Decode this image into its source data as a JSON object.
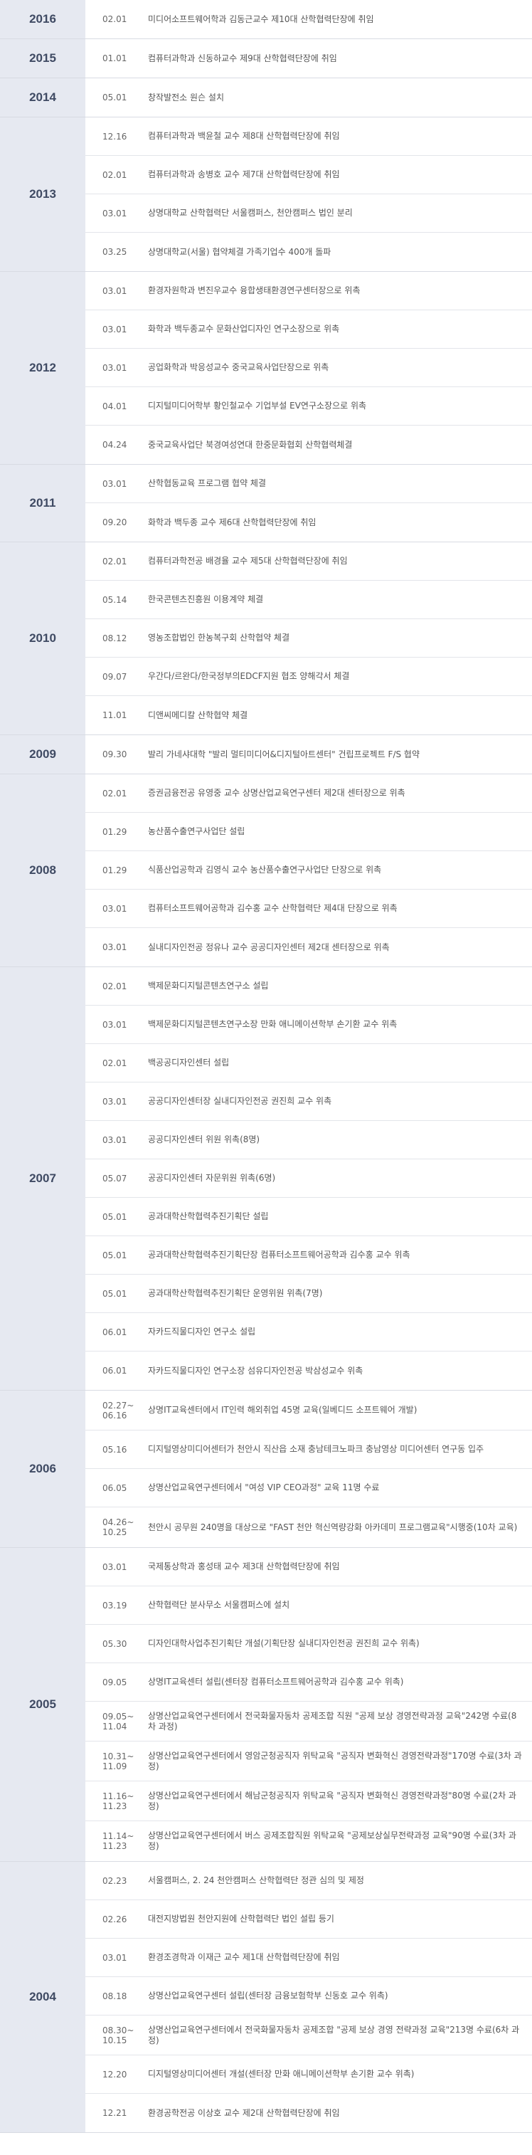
{
  "timeline": [
    {
      "year": "2016",
      "events": [
        {
          "date": "02.01",
          "text": "미디어소프트웨어학과 김동근교수 제10대 산학협력단장에 취임"
        }
      ]
    },
    {
      "year": "2015",
      "events": [
        {
          "date": "01.01",
          "text": "컴퓨터과학과 신동하교수 제9대 산학협력단장에 취임"
        }
      ]
    },
    {
      "year": "2014",
      "events": [
        {
          "date": "05.01",
          "text": "창작발전소 원슨 설치"
        }
      ]
    },
    {
      "year": "2013",
      "events": [
        {
          "date": "12.16",
          "text": "컴퓨터과학과 백윤철 교수 제8대 산학협력단장에 취임"
        },
        {
          "date": "02.01",
          "text": "컴퓨터과학과 송병호 교수 제7대 산학협력단장에 취임"
        },
        {
          "date": "03.01",
          "text": "상명대학교 산학협력단 서울캠퍼스, 천안캠퍼스 법인 분리"
        },
        {
          "date": "03.25",
          "text": "상명대학교(서울) 협약체결 가족기업수 400개 돌파"
        }
      ]
    },
    {
      "year": "2012",
      "events": [
        {
          "date": "03.01",
          "text": "환경자원학과 변진우교수 융합생태환경연구센터장으로 위촉"
        },
        {
          "date": "03.01",
          "text": "화학과 백두종교수 문화산업디자인 연구소장으로 위촉"
        },
        {
          "date": "03.01",
          "text": "공업화학과 박응성교수 중국교육사업단장으로 위촉"
        },
        {
          "date": "04.01",
          "text": "디지털미디어학부 황인철교수 기업부설 EV연구소장으로 위촉"
        },
        {
          "date": "04.24",
          "text": "중국교육사업단 북경여성연대 한중문화협회 산학협력체결"
        }
      ]
    },
    {
      "year": "2011",
      "events": [
        {
          "date": "03.01",
          "text": "산학협동교육 프로그램 협약 체결"
        },
        {
          "date": "09.20",
          "text": "화학과 백두종 교수 제6대 산학협력단장에 취임"
        }
      ]
    },
    {
      "year": "2010",
      "events": [
        {
          "date": "02.01",
          "text": "컴퓨터과학전공 배경율 교수 제5대 산학협력단장에 취임"
        },
        {
          "date": "05.14",
          "text": "한국콘텐츠진흥원 이용계약 체결"
        },
        {
          "date": "08.12",
          "text": "영농조합법인 한농복구회 산학협약 체결"
        },
        {
          "date": "09.07",
          "text": "우간다/르완다/한국정부의EDCF지원 협조 양해각서 체결"
        },
        {
          "date": "11.01",
          "text": "디앤씨메디칼 산학협약 체결"
        }
      ]
    },
    {
      "year": "2009",
      "events": [
        {
          "date": "09.30",
          "text": "발리 가네샤대학 \"발리 멀티미디어&디지털아트센터\" 건립프로젝트 F/S 협약"
        }
      ]
    },
    {
      "year": "2008",
      "events": [
        {
          "date": "02.01",
          "text": "증권금융전공 유영중 교수 상명산업교육연구센터 제2대 센터장으로 위촉"
        },
        {
          "date": "01.29",
          "text": "농산품수출연구사업단 설립"
        },
        {
          "date": "01.29",
          "text": "식품산업공학과 김영식 교수 농산품수출연구사업단 단장으로 위촉"
        },
        {
          "date": "03.01",
          "text": "컴퓨터소프트웨어공학과 김수홍 교수 산학협력단 제4대 단장으로 위촉"
        },
        {
          "date": "03.01",
          "text": "실내디자인전공 정유나 교수 공공디자인센터 제2대 센터장으로 위촉"
        }
      ]
    },
    {
      "year": "2007",
      "events": [
        {
          "date": "02.01",
          "text": "백제문화디지털콘텐츠연구소 설립"
        },
        {
          "date": "03.01",
          "text": "백제문화디지털콘텐츠연구소장 만화 애니메이션학부 손기환 교수 위촉"
        },
        {
          "date": "02.01",
          "text": "백공공디자인센터 설립"
        },
        {
          "date": "03.01",
          "text": "공공디자인센터장 실내디자인전공 권진희 교수 위촉"
        },
        {
          "date": "03.01",
          "text": "공공디자인센터 위원 위촉(8명)"
        },
        {
          "date": "05.07",
          "text": "공공디자인센터 자문위원 위촉(6명)"
        },
        {
          "date": "05.01",
          "text": "공과대학산학협력추진기획단 설립"
        },
        {
          "date": "05.01",
          "text": "공과대학산학협력추진기획단장 컴퓨터소프트웨어공학과 김수홍 교수 위촉"
        },
        {
          "date": "05.01",
          "text": "공과대학산학협력추진기획단 운영위원 위촉(7명)"
        },
        {
          "date": "06.01",
          "text": "자카드직물디자인 연구소 설립"
        },
        {
          "date": "06.01",
          "text": "자카드직물디자인 연구소장 섬유디자인전공 박삼성교수 위촉"
        }
      ]
    },
    {
      "year": "2006",
      "events": [
        {
          "date": "02.27~\n06.16",
          "text": "상명IT교육센터에서 IT인력 해외취업 45명 교육(일베디드 소프트웨어 개발)"
        },
        {
          "date": "05.16",
          "text": "디지털영상미디어센터가 천안시 직산읍 소재 충남테크노파크 충남영상 미디어센터 연구동 입주"
        },
        {
          "date": "06.05",
          "text": "상명산업교육연구센터에서 \"여성 VIP CEO과정\" 교육 11명 수료"
        },
        {
          "date": "04.26~\n10.25",
          "text": "천안시 공무원 240명을 대상으로 \"FAST 천안 혁신역량강화 아카데미 프로그램교육\"시행중(10차 교육)"
        }
      ]
    },
    {
      "year": "2005",
      "events": [
        {
          "date": "03.01",
          "text": "국제통상학과 홍성태 교수 제3대 산학협력단장에 취임"
        },
        {
          "date": "03.19",
          "text": "산학협력단 분사무소 서울캠퍼스에 설치"
        },
        {
          "date": "05.30",
          "text": "디자인대학사업추진기획단 개설(기획단장 실내디자인전공 권진희 교수 위촉)"
        },
        {
          "date": "09.05",
          "text": "상명IT교육센터 설립(센터장 컴퓨터소프트웨어공학과 김수홍 교수 위촉)"
        },
        {
          "date": "09.05~\n11.04",
          "text": "상명산업교육연구센터에서 전국화물자동차 공제조합 직원 \"공제 보상 경영전략과정 교육\"242명 수료(8차 과정)"
        },
        {
          "date": "10.31~\n11.09",
          "text": "상명산업교육연구센터에서 영암군청공직자 위탁교육 \"공직자 변화혁신 경영전략과정\"170명 수료(3차 과정)"
        },
        {
          "date": "11.16~\n11.23",
          "text": "상명산업교육연구센터에서 해남군청공직자 위탁교육 \"공직자 변화혁신 경영전략과정\"80명 수료(2차 과정)"
        },
        {
          "date": "11.14~\n11.23",
          "text": "상명산업교육연구센터에서 버스 공제조합직원 위탁교육 \"공제보상실무전략과정 교육\"90명 수료(3차 과정)"
        }
      ]
    },
    {
      "year": "2004",
      "events": [
        {
          "date": "02.23",
          "text": "서울캠퍼스, 2. 24 천안캠퍼스 산학협력단 정관 심의 및 제정"
        },
        {
          "date": "02.26",
          "text": "대전지방법원 천안지원에 산학협력단 법인 설립 등기"
        },
        {
          "date": "03.01",
          "text": "환경조경학과 이재근 교수 제1대 산학협력단장에 취임"
        },
        {
          "date": "08.18",
          "text": "상명산업교육연구센터 설립(센터장 금융보험학부 신동호 교수 위촉)"
        },
        {
          "date": "08.30~\n10.15",
          "text": "상명산업교육연구센터에서 전국화물자동차 공제조합 \"공제 보상 경영 전략과정 교육\"213명 수료(6차 과정)"
        },
        {
          "date": "12.20",
          "text": "디지털영상미디어센터 개설(센터장 만화 애니메이션학부 손기환 교수 위촉)"
        },
        {
          "date": "12.21",
          "text": "환경공학전공 이상호 교수 제2대 산학협력단장에 취임"
        }
      ]
    }
  ]
}
